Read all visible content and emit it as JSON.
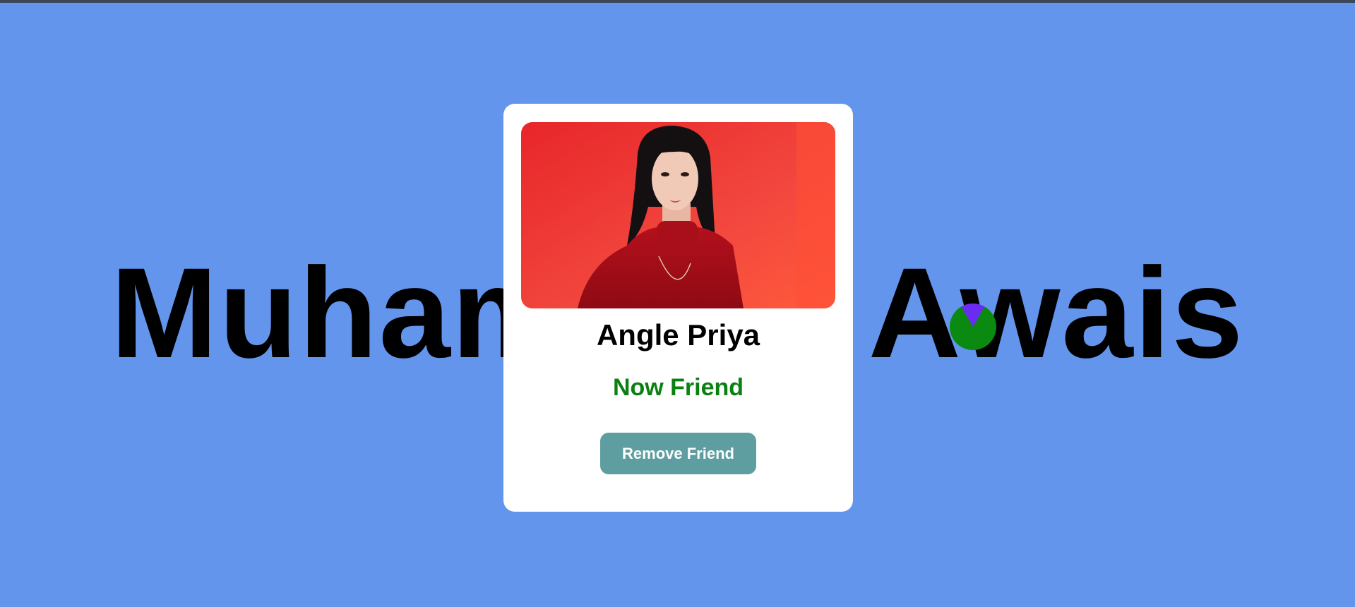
{
  "background": {
    "name_text": "Muhammad Awais",
    "color": "#6495ED"
  },
  "card": {
    "photo_alt": "Angle Priya profile photo",
    "name": "Angle Priya",
    "status": "Now Friend",
    "status_color": "#0b8012",
    "button_label": "Remove Friend",
    "button_color": "#5f9ea0"
  }
}
